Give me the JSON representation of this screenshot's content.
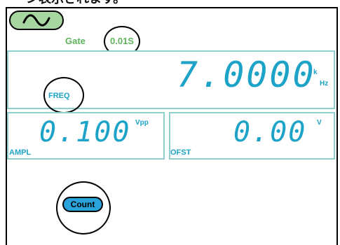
{
  "header_text": "ーン表示されます。",
  "wave_button": {
    "icon": "sine-wave-icon"
  },
  "gate": {
    "label": "Gate",
    "value": "0.01S"
  },
  "frequency": {
    "value": "7.0000",
    "unit_prefix": "k",
    "unit": "Hz",
    "label": "FREQ"
  },
  "amplitude": {
    "value": "0.100",
    "unit": "Vpp",
    "label": "AMPL"
  },
  "offset": {
    "value": "0.00",
    "unit": "V",
    "label": "OFST"
  },
  "count_button": {
    "label": "Count"
  },
  "colors": {
    "accent": "#1ca3c7",
    "gate": "#5fb45c",
    "wave_button": "#a7d7a0",
    "count_button": "#2aa3dc",
    "panel_border": "#8fd0cf"
  }
}
